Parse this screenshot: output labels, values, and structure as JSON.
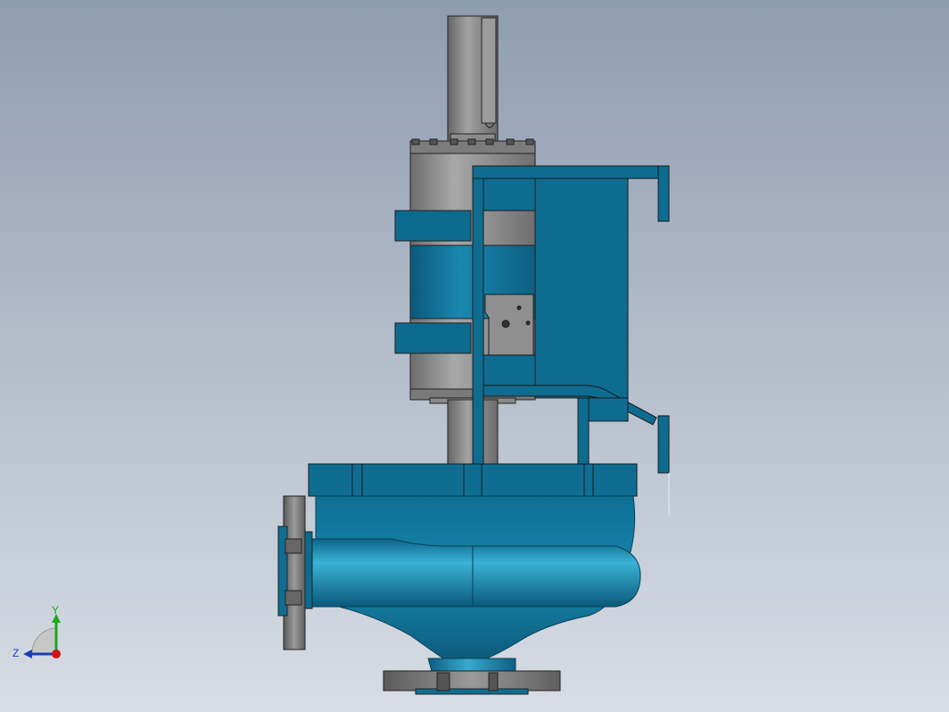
{
  "viewport": {
    "background_top": "#8f9db1",
    "background_bottom": "#d7dde4"
  },
  "model": {
    "part_color": "#0e6d92",
    "part_highlight": "#2aa0c6",
    "metal_color": "#8a8a8a"
  },
  "triad": {
    "y_label": "Y",
    "z_label": "Z",
    "y_color": "#1fa51f",
    "z_color": "#1b3fb0",
    "x_color": "#d01515"
  }
}
